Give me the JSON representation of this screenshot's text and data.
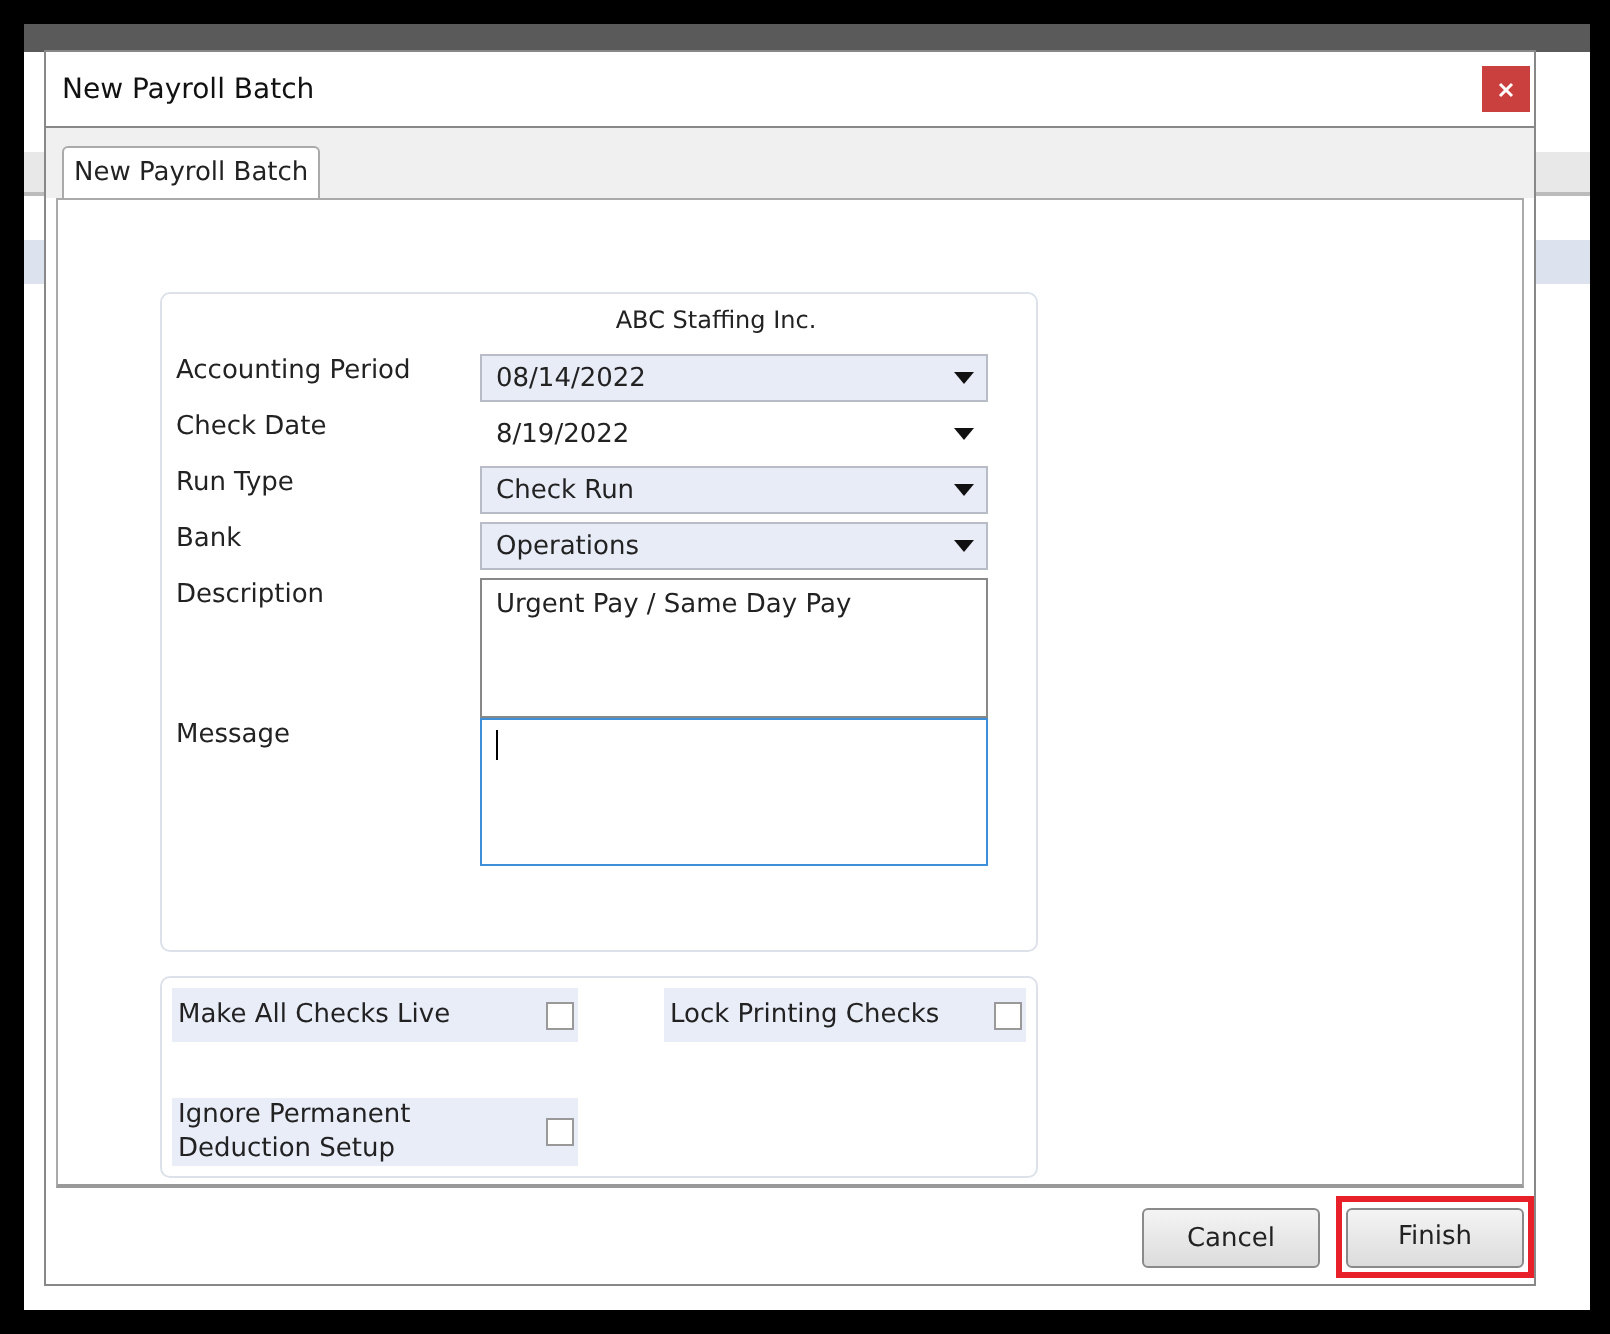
{
  "window": {
    "title": "New Payroll Batch"
  },
  "tabs": [
    {
      "label": "New Payroll Batch",
      "selected": true
    }
  ],
  "form": {
    "company": "ABC Staffing Inc.",
    "fields": [
      {
        "kind": "dropdown",
        "label": "Accounting Period",
        "value": "08/14/2022"
      },
      {
        "kind": "date",
        "label": "Check Date",
        "value": "8/19/2022"
      },
      {
        "kind": "dropdown",
        "label": "Run Type",
        "value": "Check Run"
      },
      {
        "kind": "dropdown",
        "label": "Bank",
        "value": "Operations"
      },
      {
        "kind": "textarea",
        "label": "Description",
        "value": "Urgent Pay / Same Day Pay",
        "focused": false
      },
      {
        "kind": "textarea",
        "label": "Message",
        "focused": true
      }
    ]
  },
  "options": [
    {
      "label": "Make All Checks Live",
      "checked": false
    },
    {
      "label": "Lock Printing Checks",
      "checked": false
    },
    {
      "label": "Ignore Permanent Deduction Setup",
      "checked": false
    }
  ],
  "buttons": [
    {
      "label": "Cancel",
      "highlighted": false
    },
    {
      "label": "Finish",
      "highlighted": true
    }
  ]
}
